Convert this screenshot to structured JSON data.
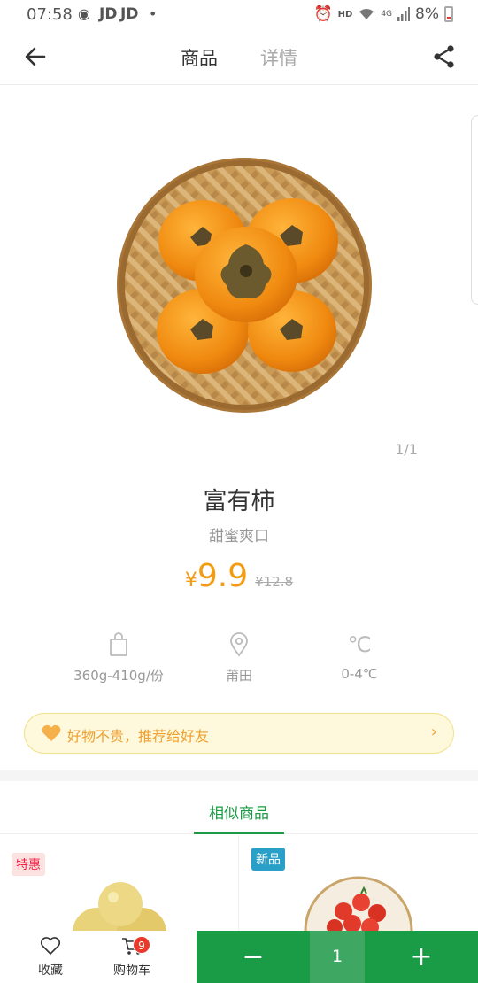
{
  "status_bar": {
    "time": "07:58",
    "app_labels": [
      "JD",
      "JD"
    ],
    "dot": "•",
    "hd": "HD",
    "network": "4G",
    "battery": "8%"
  },
  "header": {
    "tabs": [
      {
        "label": "商品",
        "active": true
      },
      {
        "label": "详情",
        "active": false
      }
    ]
  },
  "gallery": {
    "pager": "1/1"
  },
  "product": {
    "name": "富有柿",
    "subtitle": "甜蜜爽口",
    "price_currency": "¥",
    "price": "9.9",
    "original_price": "¥12.8"
  },
  "specs": [
    {
      "icon": "bag-icon",
      "text": "360g-410g/份"
    },
    {
      "icon": "location-pin-icon",
      "text": "莆田"
    },
    {
      "icon": "temperature-icon",
      "text": "0-4℃"
    }
  ],
  "recommend_banner": {
    "text": "好物不贵，推荐给好友",
    "chevron": "›"
  },
  "similar": {
    "title": "相似商品",
    "cards": [
      {
        "badge": "特惠"
      },
      {
        "badge": "新品"
      }
    ]
  },
  "bottom_bar": {
    "favorite_label": "收藏",
    "cart_label": "购物车",
    "cart_count": "9",
    "minus": "−",
    "quantity": "1",
    "plus": "+"
  },
  "colors": {
    "accent_green": "#1a9b45",
    "price_orange": "#f39c12",
    "banner_bg": "#fef9dc"
  }
}
